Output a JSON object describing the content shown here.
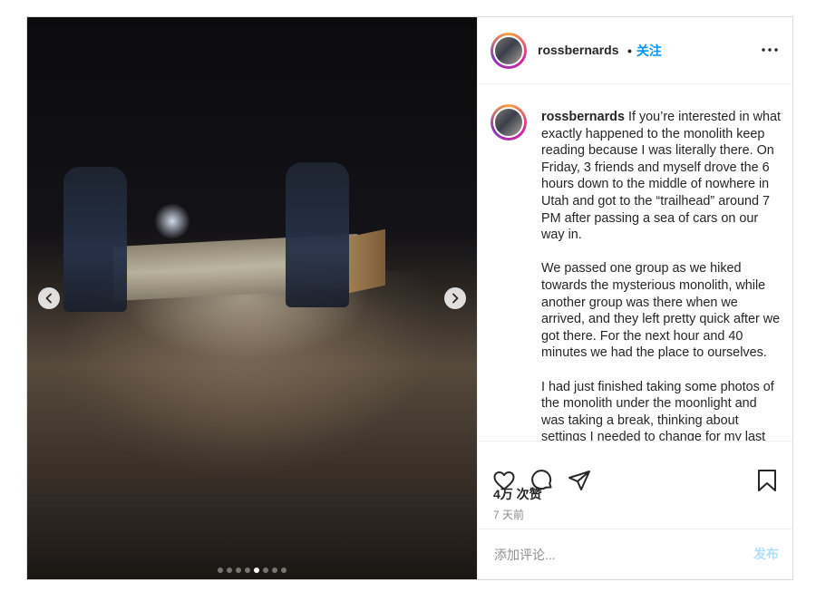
{
  "post": {
    "username": "rossbernards",
    "follow_separator": "•",
    "follow_label": "关注",
    "media": {
      "current_slide": 5,
      "total_slides": 8
    },
    "caption": {
      "username": "rossbernards",
      "paragraphs": [
        "If you’re interested in what exactly happened to the monolith keep reading because I was literally there. On Friday, 3 friends and myself drove the 6 hours down to the middle of nowhere in Utah and got to the “trailhead” around 7 PM after passing a sea of cars on our way in.",
        "We passed one group as we hiked towards the mysterious monolith, while another group was there when we arrived, and they left pretty quick after we got there. For the next hour and 40 minutes we had the place to ourselves.",
        "I had just finished taking some photos of the monolith under the moonlight and was taking a break, thinking about settings I needed to change for my last"
      ]
    },
    "likes": "4万 次赞",
    "time_ago": "7 天前",
    "comment_placeholder": "添加评论...",
    "post_button": "发布"
  },
  "icons": {
    "prev": "chevron-left-icon",
    "next": "chevron-right-icon",
    "more": "more-horizontal-icon",
    "like": "heart-icon",
    "comment": "comment-bubble-icon",
    "share": "paper-plane-icon",
    "save": "bookmark-icon"
  },
  "colors": {
    "link": "#0095f6",
    "text": "#262626",
    "muted": "#8e8e8e",
    "post_disabled": "#b2dffc",
    "border": "#dbdbdb"
  }
}
